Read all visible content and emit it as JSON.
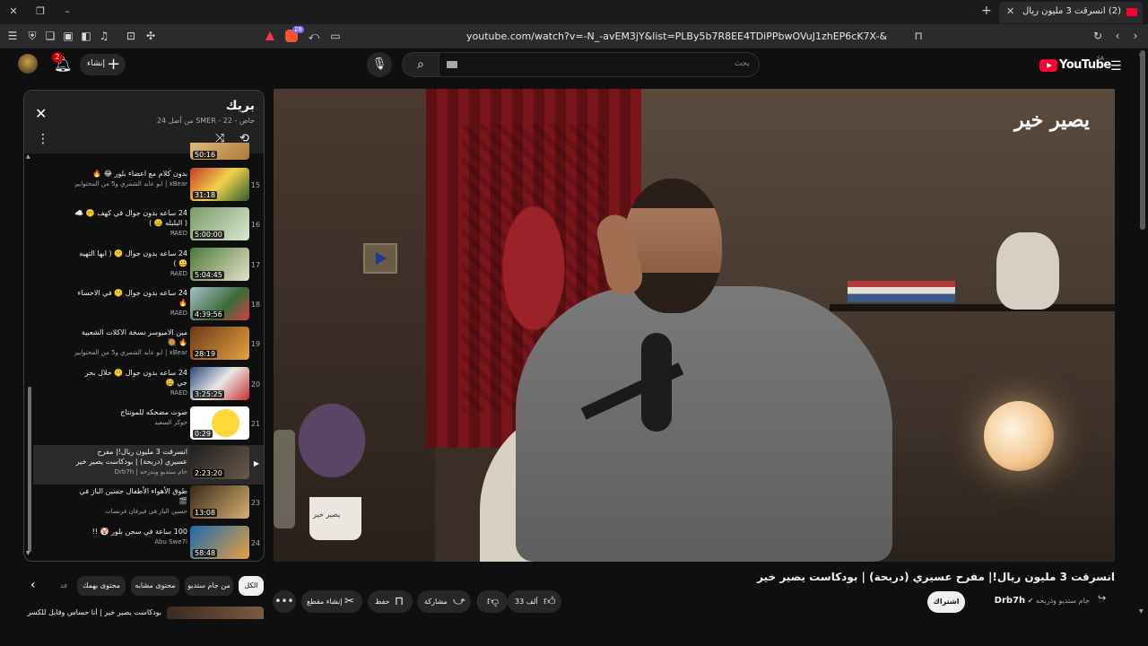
{
  "browser": {
    "tab_title": "(2) انسرقت 3 مليون ريال!| مفر",
    "url": "youtube.com/watch?v=-N_-avEM3jY&list=PLBy5b7R8EE4TDiPPbwOVuJ1zhEP6cK7X-&index=22",
    "brave_badge": "28"
  },
  "masthead": {
    "create_label": "إنشاء",
    "notifications_count": "2",
    "search_placeholder": "بحث",
    "logo_text": "YouTube",
    "logo_region": "SA"
  },
  "playlist": {
    "title": "بريك",
    "meta": "خاص - SMER - 22 من أصل 24",
    "items": [
      {
        "index": "15",
        "title": "بدون كلام مع اعضاء بلور 😂 🔥",
        "channel": "xBear | ابو عابد الشمري و5 من المحتوايين ...",
        "duration": "31:18"
      },
      {
        "index": "16",
        "title": "24 ساعه بدون جوال في كهف 🤫 ☁️ ( البلبله 🤐 )",
        "channel": "RAED",
        "duration": "5:00:00"
      },
      {
        "index": "17",
        "title": "24 ساعه بدون جوال 🤫 ( ابها التهيه 🤐 )",
        "channel": "RAED",
        "duration": "5:04:45"
      },
      {
        "index": "18",
        "title": "24 ساعه بدون جوال 🤫 في الاحساء 🔥",
        "channel": "RAED",
        "duration": "4:39:56"
      },
      {
        "index": "19",
        "title": "مين الاميوسر نسخة الاكلات الشعبية 🔥 🥘",
        "channel": "xBear | ابو عابد الشمري و5 من المحتوايين ...",
        "duration": "28:19"
      },
      {
        "index": "20",
        "title": "24 ساعه بدون جوال 🤫 خلال بحر جي 🤐",
        "channel": "RAED",
        "duration": "3:25:25"
      },
      {
        "index": "21",
        "title": "صوت مضحكه للمونتاج",
        "channel": "جوكر السعيد",
        "duration": "0:29"
      },
      {
        "index": "",
        "title": "انسرقت 3 مليون ريال!| مفرح عسيري (دربحة) | بودكاست يصير خير",
        "channel": "جام ستديو وبدرحه | Drb7h",
        "duration": "2:23:20"
      },
      {
        "index": "23",
        "title": "طوق الأهواء الأطفال حسين الباز في 🎬",
        "channel": "حسين الباز في فيرفان فرنسات",
        "duration": "13:08"
      },
      {
        "index": "24",
        "title": "100 ساعة في سجن بلور 🤡 !!",
        "channel": "Abu Swe7i",
        "duration": "58:48"
      }
    ],
    "partial_top_duration": "50:16",
    "current_indicator": "▶"
  },
  "chips": [
    "الكل",
    "من جام ستديو",
    "محتوى مشابه",
    "محتوى بهمك",
    "فد"
  ],
  "recommended_title": "بودكاست يصير خير | أنا حساس وقابل للكسر -",
  "video": {
    "title": "انسرقت 3 مليون ريال!| مفرح عسيري (دربحة) | بودكاست يصير خير",
    "watermark": "يصير خير",
    "cup_logo": "يصير خير"
  },
  "channel": {
    "name": "Drb7h",
    "owners": "جام ستديو ودربحه",
    "subscribe_label": "اشتراك"
  },
  "actions": {
    "like_count": "33 ألف",
    "share_label": "مشاركة",
    "save_label": "حفظ",
    "clip_label": "إنشاء مقطع"
  },
  "colors": {
    "background": "#0f0f0f",
    "brand_red": "#ff0033",
    "chip_bg": "#272727"
  }
}
